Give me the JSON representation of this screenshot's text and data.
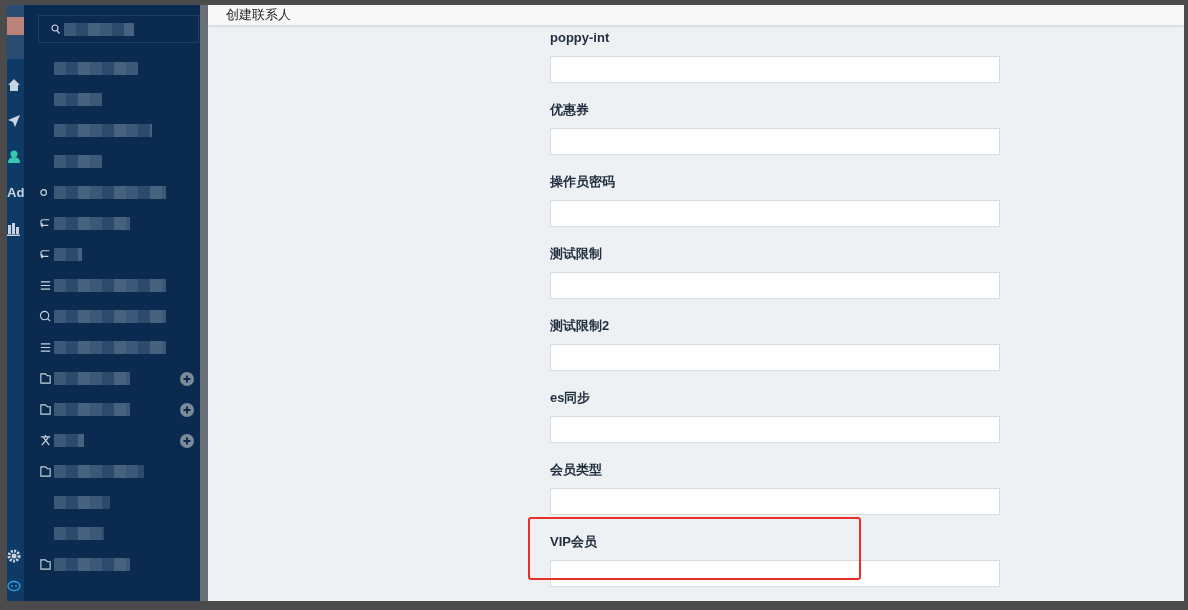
{
  "rail": {
    "items": [
      {
        "kind": "icon",
        "selected": false
      },
      {
        "kind": "icon",
        "selected": false
      },
      {
        "kind": "icon",
        "selected": true
      },
      {
        "kind": "text",
        "label": "Ad",
        "selected": false
      },
      {
        "kind": "icon",
        "selected": false
      }
    ]
  },
  "sidebar": {
    "items": [
      {
        "add_button": false
      },
      {
        "add_button": false
      },
      {
        "add_button": false
      },
      {
        "add_button": false
      },
      {
        "add_button": false
      },
      {
        "add_button": false
      },
      {
        "add_button": false
      },
      {
        "add_button": false
      },
      {
        "add_button": false
      },
      {
        "add_button": false
      },
      {
        "add_button": true
      },
      {
        "add_button": true
      },
      {
        "add_button": true
      },
      {
        "add_button": false
      },
      {
        "add_button": false
      },
      {
        "add_button": false
      },
      {
        "add_button": false
      }
    ]
  },
  "header": {
    "title": "创建联系人"
  },
  "form": {
    "fields": [
      {
        "label": "poppy-int",
        "highlighted": false
      },
      {
        "label": "优惠券",
        "highlighted": false
      },
      {
        "label": "操作员密码",
        "highlighted": false
      },
      {
        "label": "测试限制",
        "highlighted": false
      },
      {
        "label": "测试限制2",
        "highlighted": false
      },
      {
        "label": "es同步",
        "highlighted": false
      },
      {
        "label": "会员类型",
        "highlighted": false
      },
      {
        "label": "VIP会员",
        "highlighted": true
      }
    ]
  }
}
